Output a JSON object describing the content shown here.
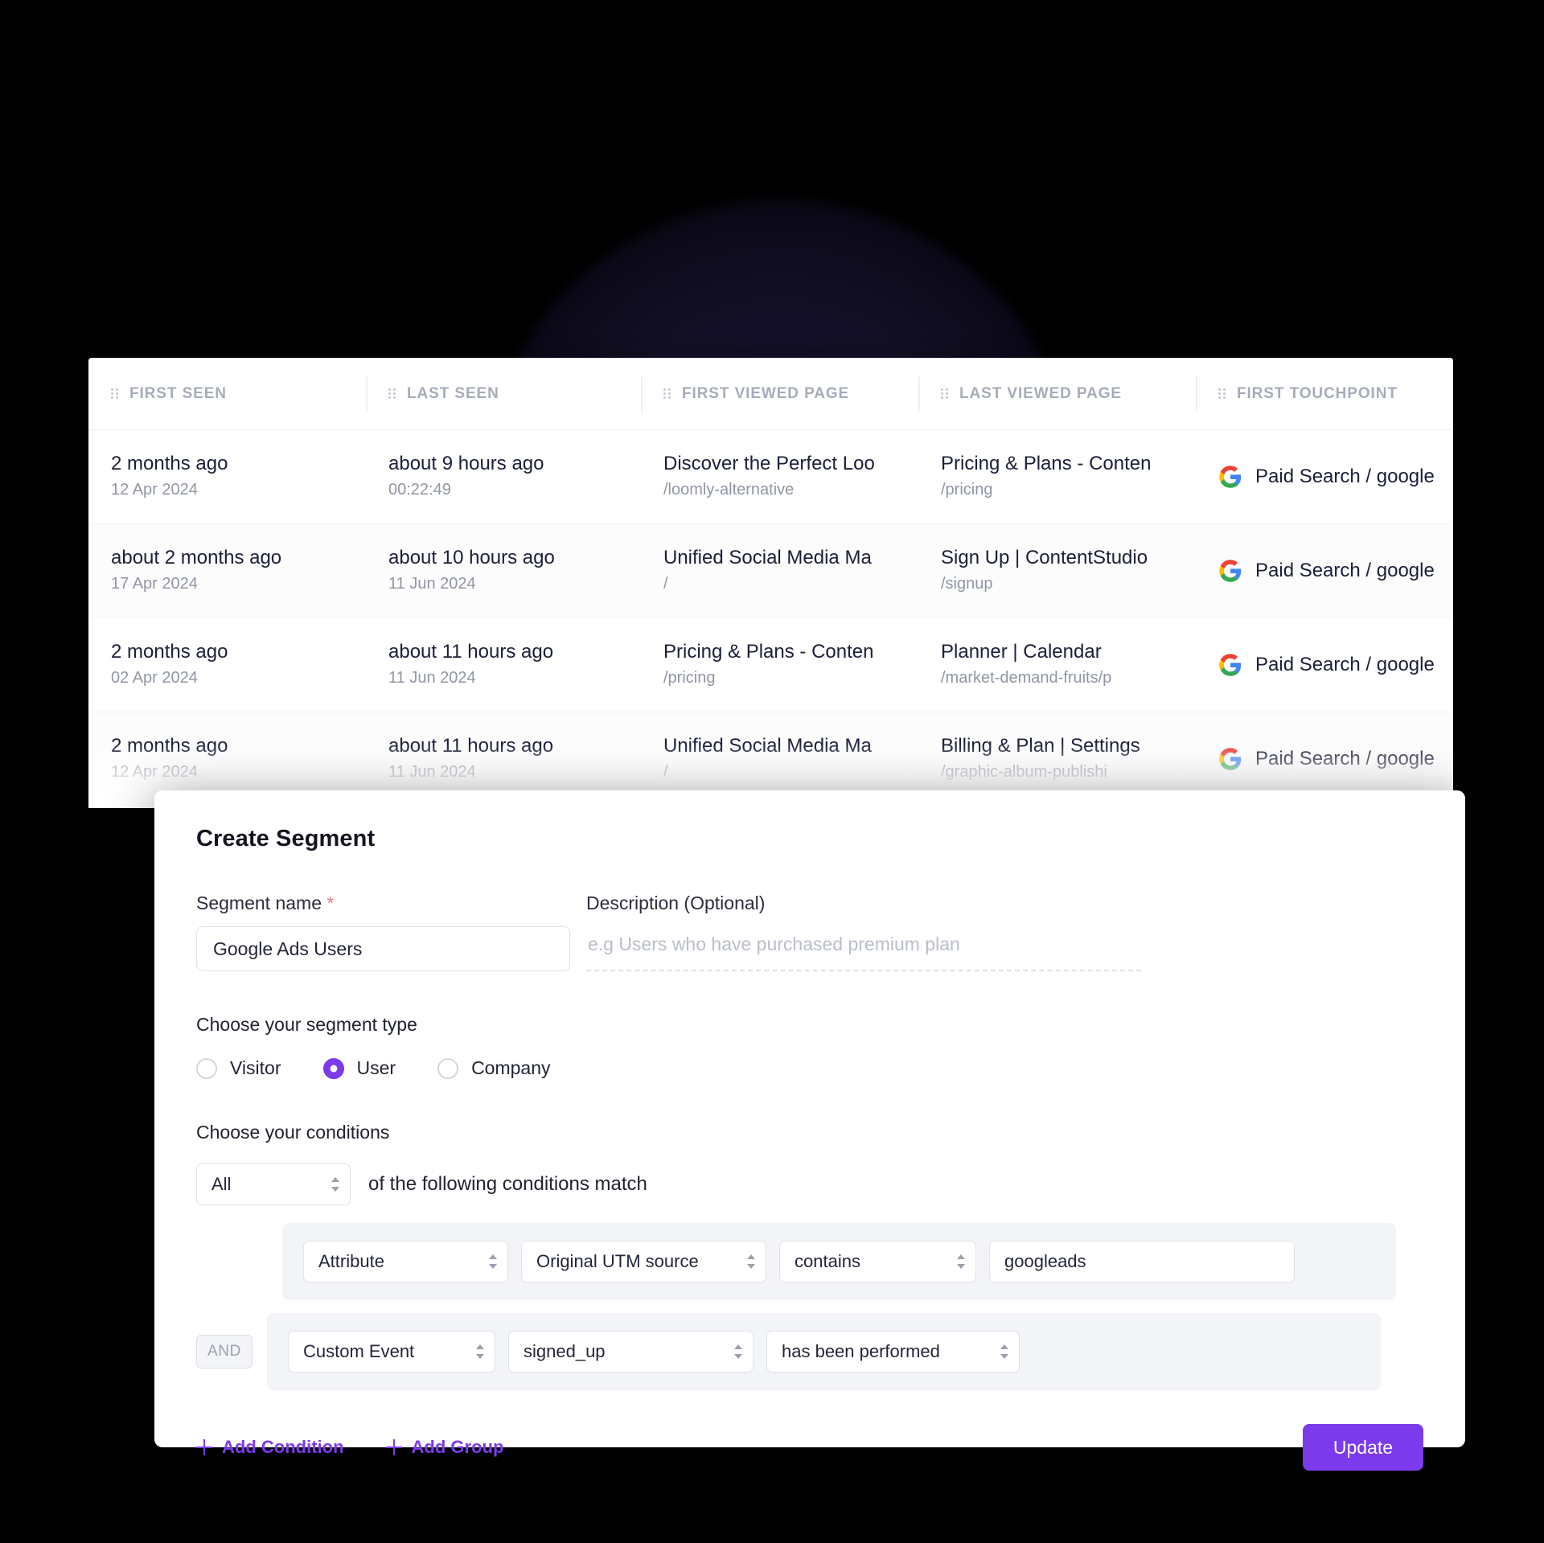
{
  "table": {
    "columns": [
      {
        "label": "FIRST SEEN"
      },
      {
        "label": "LAST SEEN"
      },
      {
        "label": "FIRST VIEWED PAGE"
      },
      {
        "label": "LAST VIEWED PAGE"
      },
      {
        "label": "FIRST TOUCHPOINT"
      }
    ],
    "rows": [
      {
        "first_seen": "2 months ago",
        "first_seen_date": "12 Apr 2024",
        "last_seen": "about 9 hours ago",
        "last_seen_date": "00:22:49",
        "first_viewed_page": "Discover the Perfect Loo",
        "first_viewed_path": "/loomly-alternative",
        "last_viewed_page": "Pricing & Plans - Conten",
        "last_viewed_path": "/pricing",
        "first_touchpoint": "Paid Search / google",
        "first_touchpoint_icon": "google-icon"
      },
      {
        "first_seen": "about 2 months ago",
        "first_seen_date": "17 Apr 2024",
        "last_seen": "about 10 hours ago",
        "last_seen_date": "11 Jun 2024",
        "first_viewed_page": "Unified Social Media Ma",
        "first_viewed_path": "/",
        "last_viewed_page": "Sign Up | ContentStudio",
        "last_viewed_path": "/signup",
        "first_touchpoint": "Paid Search / google",
        "first_touchpoint_icon": "google-icon"
      },
      {
        "first_seen": "2 months ago",
        "first_seen_date": "02 Apr 2024",
        "last_seen": "about 11 hours ago",
        "last_seen_date": "11 Jun 2024",
        "first_viewed_page": "Pricing & Plans - Conten",
        "first_viewed_path": "/pricing",
        "last_viewed_page": "Planner | Calendar",
        "last_viewed_path": "/market-demand-fruits/p",
        "first_touchpoint": "Paid Search / google",
        "first_touchpoint_icon": "google-icon"
      },
      {
        "first_seen": "2 months ago",
        "first_seen_date": "12 Apr 2024",
        "last_seen": "about 11 hours ago",
        "last_seen_date": "11 Jun 2024",
        "first_viewed_page": "Unified Social Media Ma",
        "first_viewed_path": "/",
        "last_viewed_page": "Billing & Plan | Settings",
        "last_viewed_path": "/graphic-album-publishi",
        "first_touchpoint": "Paid Search / google",
        "first_touchpoint_icon": "google-icon"
      }
    ]
  },
  "modal": {
    "title": "Create Segment",
    "segment_name_label": "Segment name",
    "segment_name_required_mark": "*",
    "segment_name_value": "Google Ads Users",
    "segment_name_placeholder": "Segment name",
    "description_label": "Description (Optional)",
    "description_value": "",
    "description_placeholder": "e.g Users who have purchased premium plan",
    "segment_type_label": "Choose your segment type",
    "segment_type_options": [
      {
        "label": "Visitor",
        "selected": false
      },
      {
        "label": "User",
        "selected": true
      },
      {
        "label": "Company",
        "selected": false
      }
    ],
    "conditions_label": "Choose your conditions",
    "match_select_value": "All",
    "match_text": "of the following conditions match",
    "condition_groups": [
      {
        "joiner": "",
        "fields": [
          {
            "type": "select",
            "value": "Attribute"
          },
          {
            "type": "select",
            "value": "Original UTM source"
          },
          {
            "type": "select",
            "value": "contains"
          },
          {
            "type": "text",
            "value": "googleads"
          }
        ]
      },
      {
        "joiner": "AND",
        "fields": [
          {
            "type": "select",
            "value": "Custom Event"
          },
          {
            "type": "select",
            "value": "signed_up"
          },
          {
            "type": "select",
            "value": "has been performed"
          }
        ]
      }
    ],
    "add_condition_label": "Add Condition",
    "add_group_label": "Add Group",
    "update_label": "Update",
    "accent_color": "#7c3aed"
  }
}
